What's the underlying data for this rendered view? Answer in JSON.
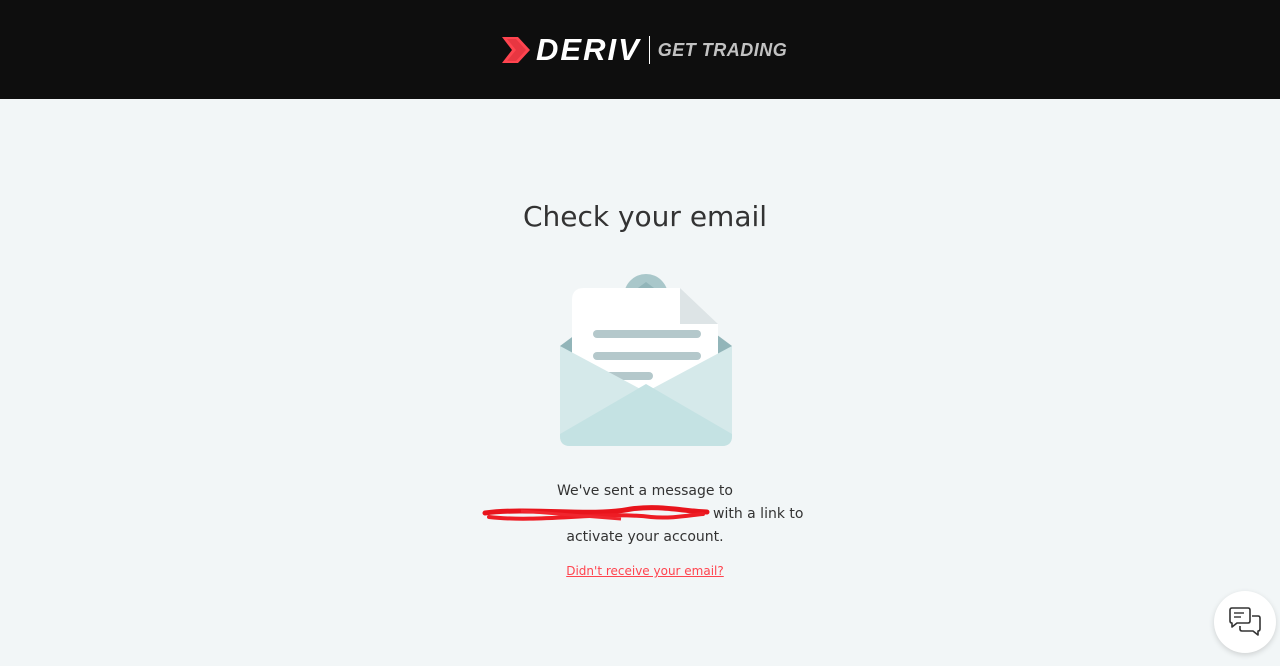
{
  "header": {
    "brand": "DERIV",
    "tagline": "GET TRADING",
    "brand_color": "#ff444f"
  },
  "main": {
    "title": "Check your email",
    "illustration": "open-envelope-icon",
    "message_prefix": "We've sent a message to",
    "message_suffix": "with a link to activate your account.",
    "resend_link": "Didn't receive your email?"
  },
  "chat": {
    "icon": "chat-bubbles-icon"
  },
  "colors": {
    "header_bg": "#0e0e0e",
    "page_bg": "#f2f6f7",
    "link": "#ff444f",
    "text": "#333333"
  }
}
